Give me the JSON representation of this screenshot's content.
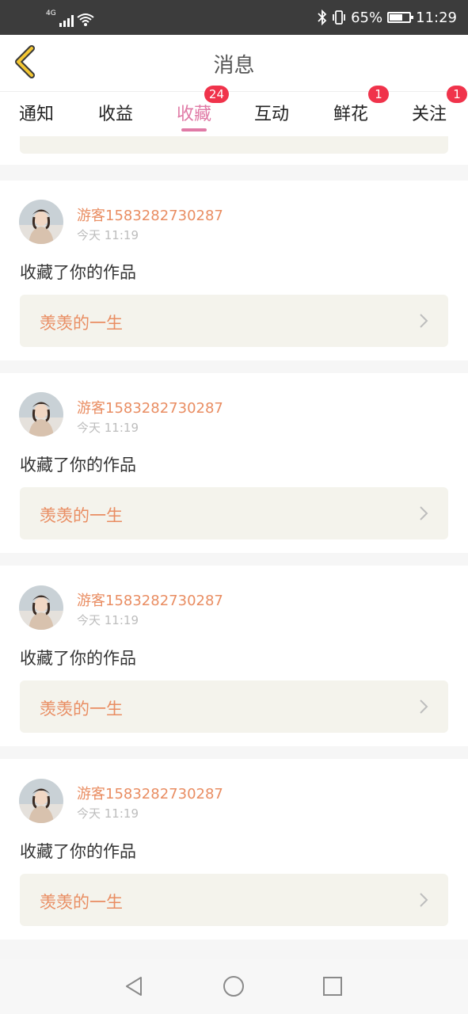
{
  "status": {
    "network": "4G",
    "battery": "65%",
    "time": "11:29"
  },
  "header": {
    "title": "消息"
  },
  "tabs": [
    {
      "label": "通知",
      "badge": ""
    },
    {
      "label": "收益",
      "badge": ""
    },
    {
      "label": "收藏",
      "badge": "24"
    },
    {
      "label": "互动",
      "badge": ""
    },
    {
      "label": "鲜花",
      "badge": "1"
    },
    {
      "label": "关注",
      "badge": "1"
    }
  ],
  "active_tab": "收藏",
  "items": [
    {
      "user": "游客1583282730287",
      "time": "今天 11:19",
      "action": "收藏了你的作品",
      "work_title": "羡羡的一生"
    },
    {
      "user": "游客1583282730287",
      "time": "今天 11:19",
      "action": "收藏了你的作品",
      "work_title": "羡羡的一生"
    },
    {
      "user": "游客1583282730287",
      "time": "今天 11:19",
      "action": "收藏了你的作品",
      "work_title": "羡羡的一生"
    },
    {
      "user": "游客1583282730287",
      "time": "今天 11:19",
      "action": "收藏了你的作品",
      "work_title": "羡羡的一生"
    }
  ],
  "colors": {
    "accent_pink": "#e07aa6",
    "username_orange": "#e98d62",
    "badge_red": "#f0334b",
    "card_bg": "#f4f3ec"
  },
  "icons": {
    "back": "back-chevron-icon",
    "work_arrow": "chevron-right-icon",
    "nav_back": "triangle-back-icon",
    "nav_home": "circle-home-icon",
    "nav_recent": "square-recent-icon"
  }
}
